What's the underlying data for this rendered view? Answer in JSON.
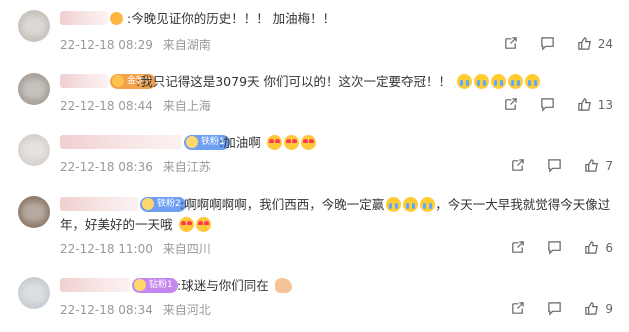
{
  "comments": [
    {
      "text": ":今晚见证你的历史！！！ 加油梅！！",
      "time": "22-12-18 08:29",
      "location": "来自湖南",
      "likes": "24",
      "badge": ""
    },
    {
      "text": ":我只记得这是3079天 你们可以的！这次一定要夺冠！！",
      "time": "22-12-18 08:44",
      "location": "来自上海",
      "likes": "13",
      "badge": "金粉2"
    },
    {
      "text": ":加油啊",
      "time": "22-12-18 08:36",
      "location": "来自江苏",
      "likes": "7",
      "badge": "铁粉1"
    },
    {
      "text": ":啊啊啊啊啊，我们西西，今晚一定赢",
      "text_tail": "，今天一大早我就觉得今天像过",
      "text_line2": "年，好美好的一天哦",
      "time": "22-12-18 11:00",
      "location": "来自四川",
      "likes": "6",
      "badge": "铁粉2"
    },
    {
      "text": ":球迷与你们同在",
      "time": "22-12-18 08:34",
      "location": "来自河北",
      "likes": "9",
      "badge": "钻粉1"
    }
  ],
  "icons": {
    "share": "share-icon",
    "reply": "comment-icon",
    "like": "thumbs-up-icon"
  }
}
